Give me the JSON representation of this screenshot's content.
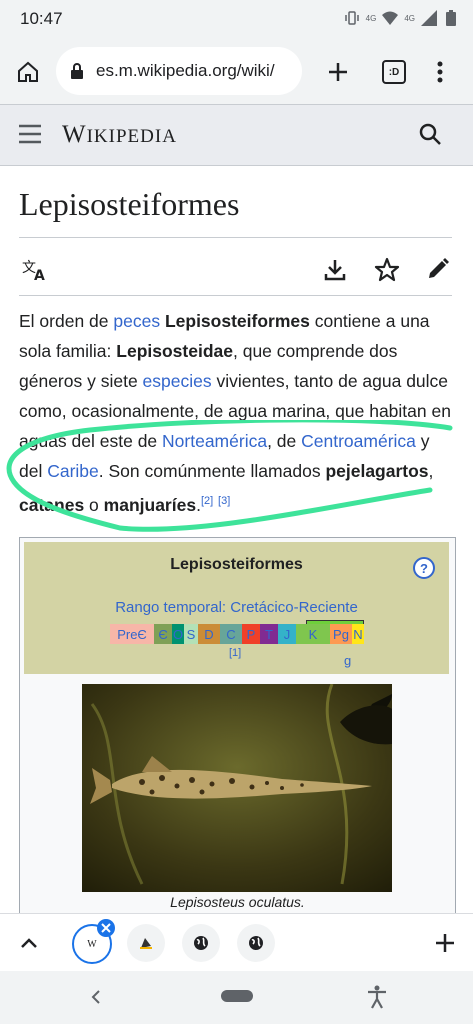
{
  "status_bar": {
    "time": "10:47",
    "network_label": "4G"
  },
  "browser": {
    "url": "es.m.wikipedia.org/wiki/",
    "tab_count": ":D"
  },
  "wiki": {
    "logo_big": "W",
    "logo_rest": "IKIPEDIA"
  },
  "article": {
    "title": "Lepisosteiformes",
    "paragraph": {
      "t1": "El orden de ",
      "l1": "peces",
      "t2": " ",
      "b1": "Lepisosteiformes",
      "t3": " contiene a una sola familia: ",
      "b2": "Lepisosteidae",
      "t4": ", que comprende dos géneros y siete ",
      "l2": "especies",
      "t5": " vivientes, tanto de agua dulce como, ocasionalmente, de agua marina, que habitan en aguas del este de ",
      "l3": "Norteamérica",
      "t6": ", de ",
      "l4": "Centroamérica",
      "t7": " y del ",
      "l5": "Caribe",
      "t8": ". Son comúnmente llamados ",
      "b3": "pejelagartos",
      "t9": ", ",
      "b4": "catanes",
      "t10": " o ",
      "b5": "manjuaríes",
      "t11": ".",
      "ref1": "[2]",
      "ref2": "[3]"
    }
  },
  "infobox": {
    "title": "Lepisosteiformes",
    "help": "?",
    "range": "Rango temporal: Cretácico-Reciente",
    "ref": "[1]",
    "g": "g",
    "segments": [
      {
        "label": "PreЄ",
        "color": "#f7b6a8"
      },
      {
        "label": "Є",
        "color": "#7fa056"
      },
      {
        "label": "O",
        "color": "#009270"
      },
      {
        "label": "S",
        "color": "#b3e1b6"
      },
      {
        "label": "D",
        "color": "#cb8c37"
      },
      {
        "label": "C",
        "color": "#67a599"
      },
      {
        "label": "P",
        "color": "#f04028"
      },
      {
        "label": "T",
        "color": "#812b92"
      },
      {
        "label": "J",
        "color": "#34b2c9"
      },
      {
        "label": "K",
        "color": "#7fc64e"
      },
      {
        "label": "Pg",
        "color": "#fd9a52"
      },
      {
        "label": "N",
        "color": "#ffe619"
      }
    ],
    "caption": "Lepisosteus oculatus."
  },
  "icons": {
    "home": "home-icon",
    "lock": "lock-icon",
    "new_tab": "plus-icon",
    "menu": "more-vert-icon",
    "hamburger": "hamburger-icon",
    "search": "search-icon",
    "translate": "translate-icon",
    "download": "download-icon",
    "star": "star-icon",
    "edit": "pencil-icon"
  }
}
